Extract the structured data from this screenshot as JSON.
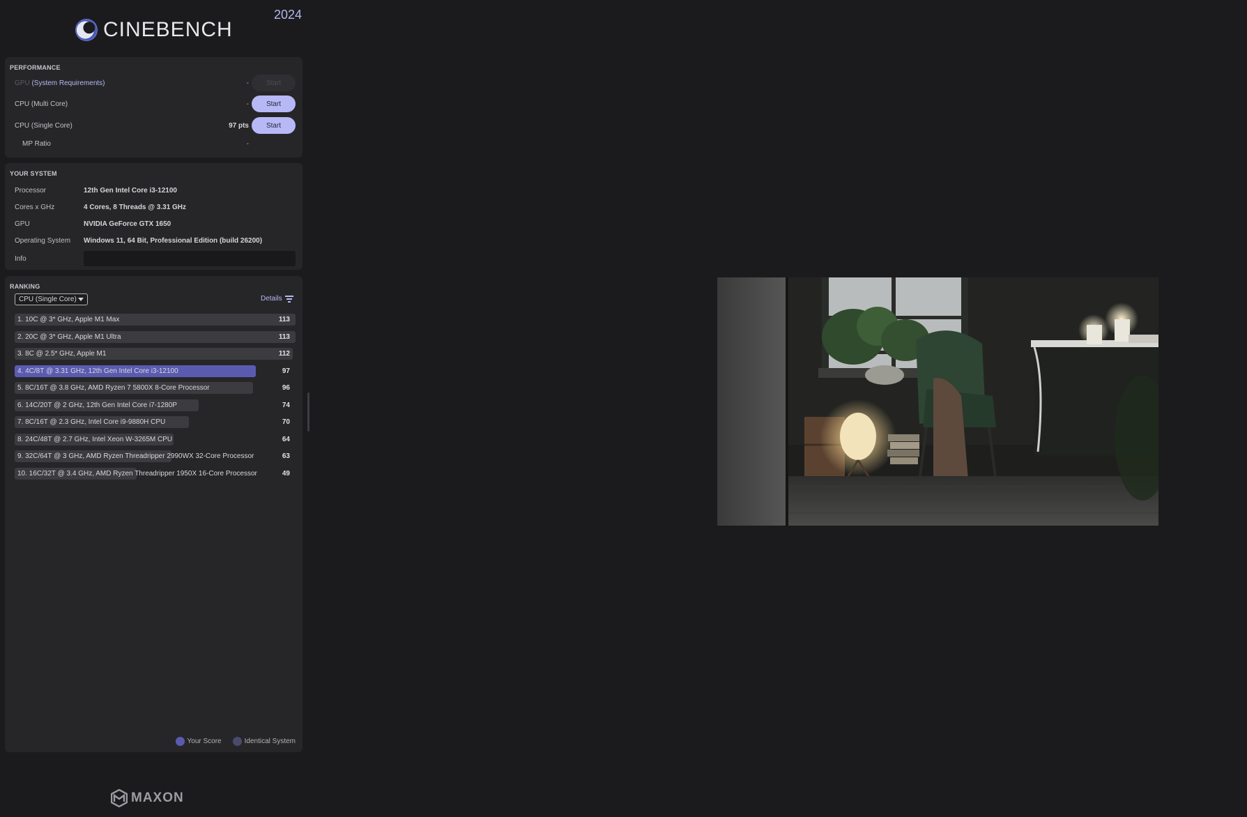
{
  "app": {
    "name": "CINEBENCH",
    "year": "2024",
    "footer_brand": "MAXON"
  },
  "performance": {
    "title": "PERFORMANCE",
    "gpu": {
      "label_dim": "GPU",
      "label_link": "(System Requirements)",
      "value": "-",
      "button": "Start"
    },
    "cpu_multi": {
      "label": "CPU (Multi Core)",
      "value": "-",
      "button": "Start"
    },
    "cpu_single": {
      "label": "CPU (Single Core)",
      "value": "97 pts",
      "button": "Start"
    },
    "mp_ratio": {
      "label": "MP Ratio",
      "value": "-"
    }
  },
  "system": {
    "title": "YOUR SYSTEM",
    "rows": [
      {
        "key": "Processor",
        "value": "12th Gen Intel Core i3-12100"
      },
      {
        "key": "Cores x GHz",
        "value": "4 Cores, 8 Threads @ 3.31 GHz"
      },
      {
        "key": "GPU",
        "value": "NVIDIA GeForce GTX 1650"
      },
      {
        "key": "Operating System",
        "value": "Windows 11, 64 Bit, Professional Edition (build 26200)"
      },
      {
        "key": "Info",
        "value": ""
      }
    ]
  },
  "ranking": {
    "title": "RANKING",
    "selected_test": "CPU (Single Core)",
    "details_label": "Details",
    "max_score": 113,
    "entries": [
      {
        "label": "1. 10C @ 3* GHz, Apple M1 Max",
        "score": 113,
        "mine": false
      },
      {
        "label": "2. 20C @ 3* GHz, Apple M1 Ultra",
        "score": 113,
        "mine": false
      },
      {
        "label": "3. 8C @ 2.5* GHz, Apple M1",
        "score": 112,
        "mine": false
      },
      {
        "label": "4. 4C/8T @ 3.31 GHz, 12th Gen Intel Core i3-12100",
        "score": 97,
        "mine": true
      },
      {
        "label": "5. 8C/16T @ 3.8 GHz, AMD Ryzen 7 5800X 8-Core Processor",
        "score": 96,
        "mine": false
      },
      {
        "label": "6. 14C/20T @ 2 GHz, 12th Gen Intel Core i7-1280P",
        "score": 74,
        "mine": false
      },
      {
        "label": "7. 8C/16T @ 2.3 GHz, Intel Core i9-9880H CPU",
        "score": 70,
        "mine": false
      },
      {
        "label": "8. 24C/48T @ 2.7 GHz, Intel Xeon W-3265M CPU",
        "score": 64,
        "mine": false
      },
      {
        "label": "9. 32C/64T @ 3 GHz, AMD Ryzen Threadripper 2990WX 32-Core Processor",
        "score": 63,
        "mine": false
      },
      {
        "label": "10. 16C/32T @ 3.4 GHz, AMD Ryzen Threadripper 1950X 16-Core Processor",
        "score": 49,
        "mine": false
      }
    ],
    "legend": {
      "your_score": "Your Score",
      "identical_system": "Identical System"
    }
  },
  "colors": {
    "background": "#1b1b1d",
    "panel": "#262629",
    "accent": "#b7b9f6",
    "your_score": "#5a5bb0",
    "identical_system": "#4a4a6a"
  },
  "icons": {
    "logo": "cinebench-logo-icon",
    "dropdown": "chevron-down-icon",
    "filter": "filter-icon",
    "footer": "maxon-logo-icon"
  }
}
